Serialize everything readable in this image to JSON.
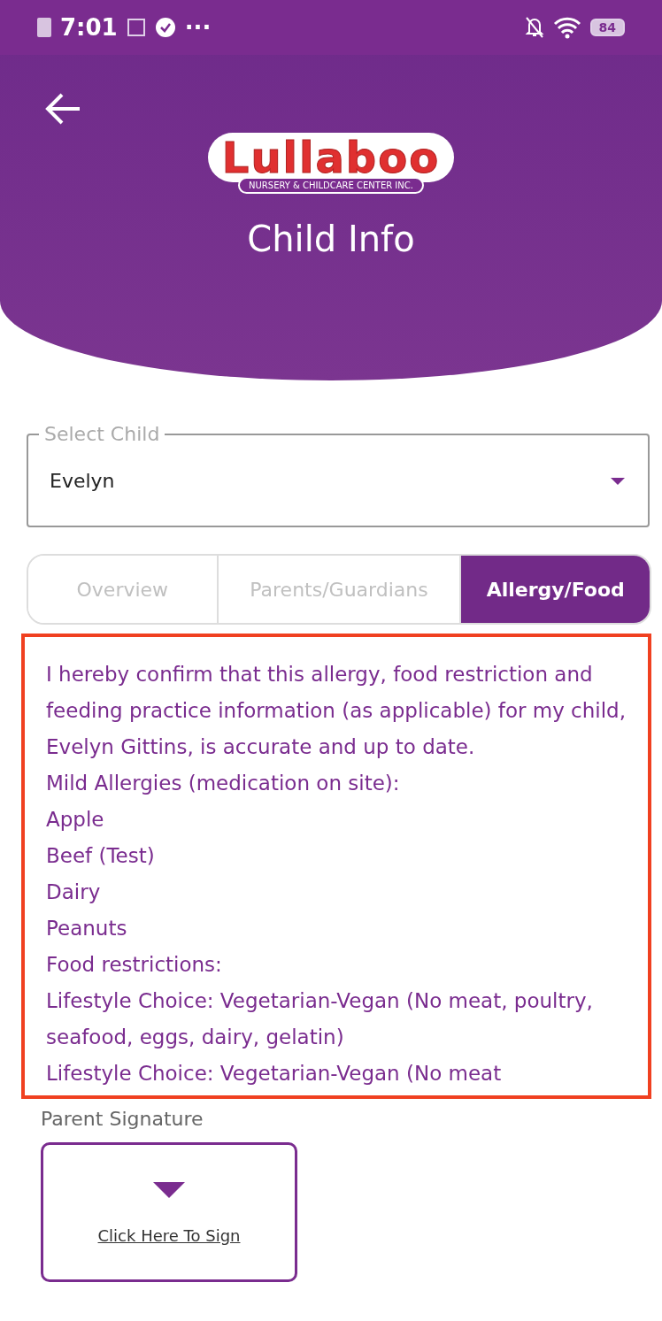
{
  "status_bar": {
    "time": "7:01",
    "more": "···",
    "battery": "84"
  },
  "header": {
    "logo": {
      "name": "Lullaboo",
      "tagline": "NURSERY & CHILDCARE CENTER INC."
    },
    "title": "Child Info"
  },
  "select_child": {
    "label": "Select Child",
    "value": "Evelyn"
  },
  "tabs": [
    {
      "label": "Overview",
      "selected": false
    },
    {
      "label": "Parents/Guardians",
      "selected": false
    },
    {
      "label": "Allergy/Food",
      "selected": true
    }
  ],
  "allergy_text": {
    "highlighted": true,
    "lines": [
      "I hereby confirm that this allergy, food restriction and feeding practice information (as applicable) for my child, Evelyn Gittins, is accurate and up to date.",
      "Mild Allergies (medication on site):",
      "Apple",
      "Beef (Test)",
      "Dairy",
      "Peanuts",
      "Food restrictions:",
      "Lifestyle Choice: Vegetarian-Vegan (No meat, poultry, seafood, eggs, dairy, gelatin)",
      "Lifestyle Choice: Vegetarian-Vegan (No meat"
    ]
  },
  "signature": {
    "label": "Parent Signature",
    "button": "Click Here To Sign"
  }
}
